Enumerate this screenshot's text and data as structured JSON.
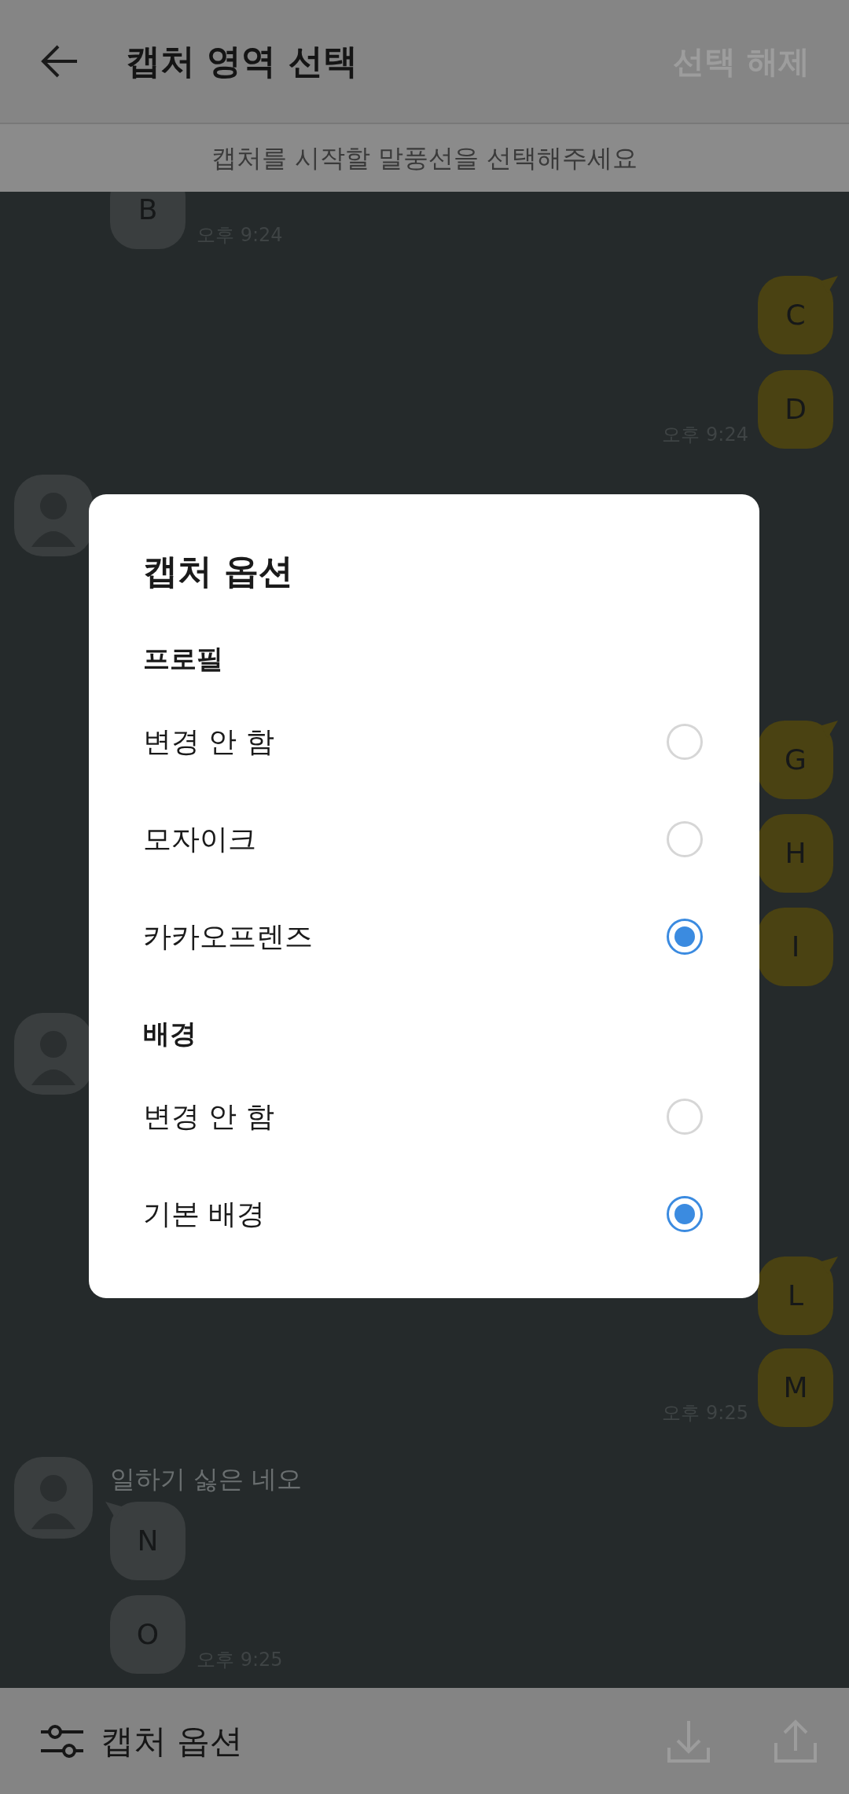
{
  "header": {
    "title": "캡처 영역 선택",
    "action": "선택 해제"
  },
  "hint": "캡처를 시작할 말풍선을 선택해주세요",
  "chat": [
    {
      "kind": "received",
      "text": "B",
      "time": "오후 9:24"
    },
    {
      "kind": "sent",
      "text": "C"
    },
    {
      "kind": "sent",
      "text": "D",
      "time": "오후 9:24"
    },
    {
      "kind": "profile"
    },
    {
      "kind": "sent",
      "text": "G"
    },
    {
      "kind": "sent",
      "text": "H"
    },
    {
      "kind": "sent",
      "text": "I"
    },
    {
      "kind": "profile"
    },
    {
      "kind": "sent",
      "text": "L"
    },
    {
      "kind": "sent",
      "text": "M",
      "time": "오후 9:25"
    },
    {
      "kind": "profile",
      "name": "일하기 싫은 네오"
    },
    {
      "kind": "received",
      "text": "N"
    },
    {
      "kind": "received",
      "text": "O",
      "time": "오후 9:25"
    }
  ],
  "dialog": {
    "title": "캡처 옵션",
    "sections": [
      {
        "heading": "프로필",
        "options": [
          {
            "label": "변경 안 함",
            "selected": false
          },
          {
            "label": "모자이크",
            "selected": false
          },
          {
            "label": "카카오프렌즈",
            "selected": true
          }
        ]
      },
      {
        "heading": "배경",
        "options": [
          {
            "label": "변경 안 함",
            "selected": false
          },
          {
            "label": "기본 배경",
            "selected": true
          }
        ]
      }
    ]
  },
  "bottom_bar": {
    "label": "캡처 옵션"
  }
}
